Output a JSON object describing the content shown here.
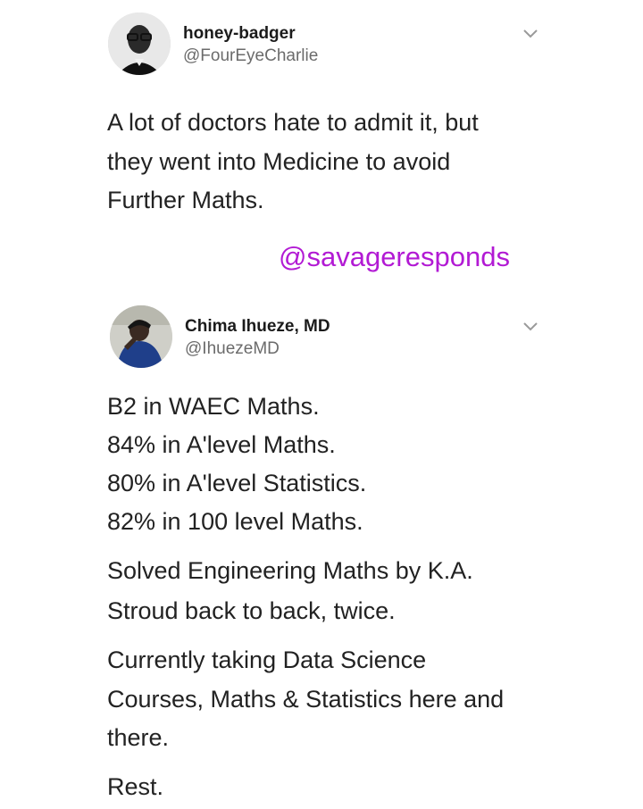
{
  "tweets": [
    {
      "display_name": "honey-badger",
      "handle": "@FourEyeCharlie",
      "menu_icon": "chevron-down-icon",
      "lines": [
        "A lot of doctors hate to admit it, but",
        "they went into Medicine to avoid",
        "Further Maths."
      ]
    },
    {
      "display_name": "Chima Ihueze, MD",
      "handle": "@IhuezeMD",
      "menu_icon": "chevron-down-icon",
      "lines": [
        "B2 in WAEC Maths.",
        "84% in A'level Maths.",
        "80% in A'level Statistics.",
        "82% in 100 level Maths.",
        "Solved Engineering Maths by K.A.",
        "Stroud back to back, twice.",
        "Currently taking Data Science",
        "Courses, Maths & Statistics here and",
        "there.",
        "Rest."
      ]
    }
  ],
  "watermark": "@savageresponds",
  "colors": {
    "watermark": "#b21ad4",
    "handle": "#6b6b6b",
    "text": "#222222"
  }
}
